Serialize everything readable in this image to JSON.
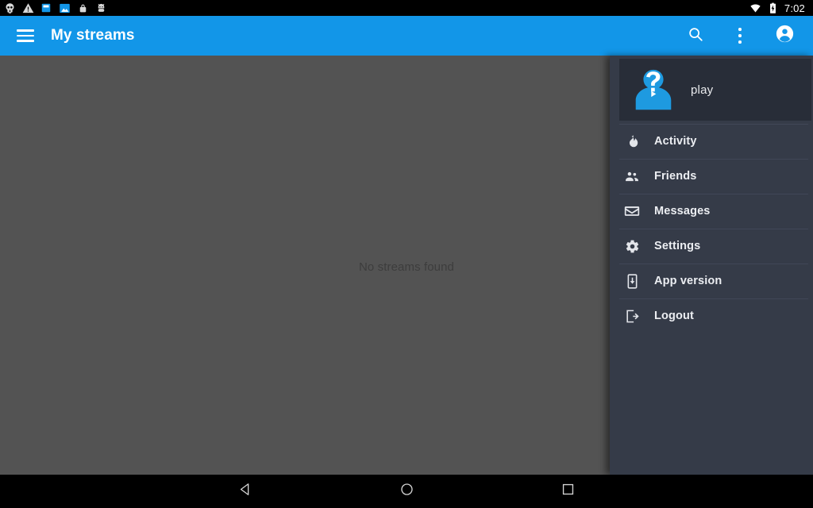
{
  "statusbar": {
    "time": "7:02",
    "left_icons": [
      {
        "name": "skull-face-icon"
      },
      {
        "name": "warning-triangle-icon"
      },
      {
        "name": "sd-card-icon"
      },
      {
        "name": "photo-icon"
      },
      {
        "name": "lock-icon"
      },
      {
        "name": "android-bug-icon"
      }
    ],
    "right_icons": [
      {
        "name": "wifi-icon"
      },
      {
        "name": "battery-charging-icon"
      }
    ]
  },
  "toolbar": {
    "title": "My streams",
    "menu_icon": "hamburger-menu-icon",
    "search_icon": "search-icon",
    "overflow_icon": "overflow-menu-icon",
    "account_icon": "account-circle-icon",
    "accent_color": "#1296e8"
  },
  "main": {
    "empty_message": "No streams found",
    "background_color": "#535353"
  },
  "drawer": {
    "background_color": "#353b48",
    "header_background_color": "#282d38",
    "avatar_color": "#1e9ae0",
    "profile": {
      "username": "play",
      "avatar_name": "unknown-user-avatar"
    },
    "items": [
      {
        "label": "Activity",
        "icon": "flame-icon"
      },
      {
        "label": "Friends",
        "icon": "people-icon"
      },
      {
        "label": "Messages",
        "icon": "envelope-icon"
      },
      {
        "label": "Settings",
        "icon": "gear-icon"
      },
      {
        "label": "App version",
        "icon": "system-update-icon"
      },
      {
        "label": "Logout",
        "icon": "exit-icon"
      }
    ]
  },
  "navbar": {
    "back_icon": "back-triangle-icon",
    "home_icon": "home-circle-icon",
    "recents_icon": "recents-square-icon"
  }
}
